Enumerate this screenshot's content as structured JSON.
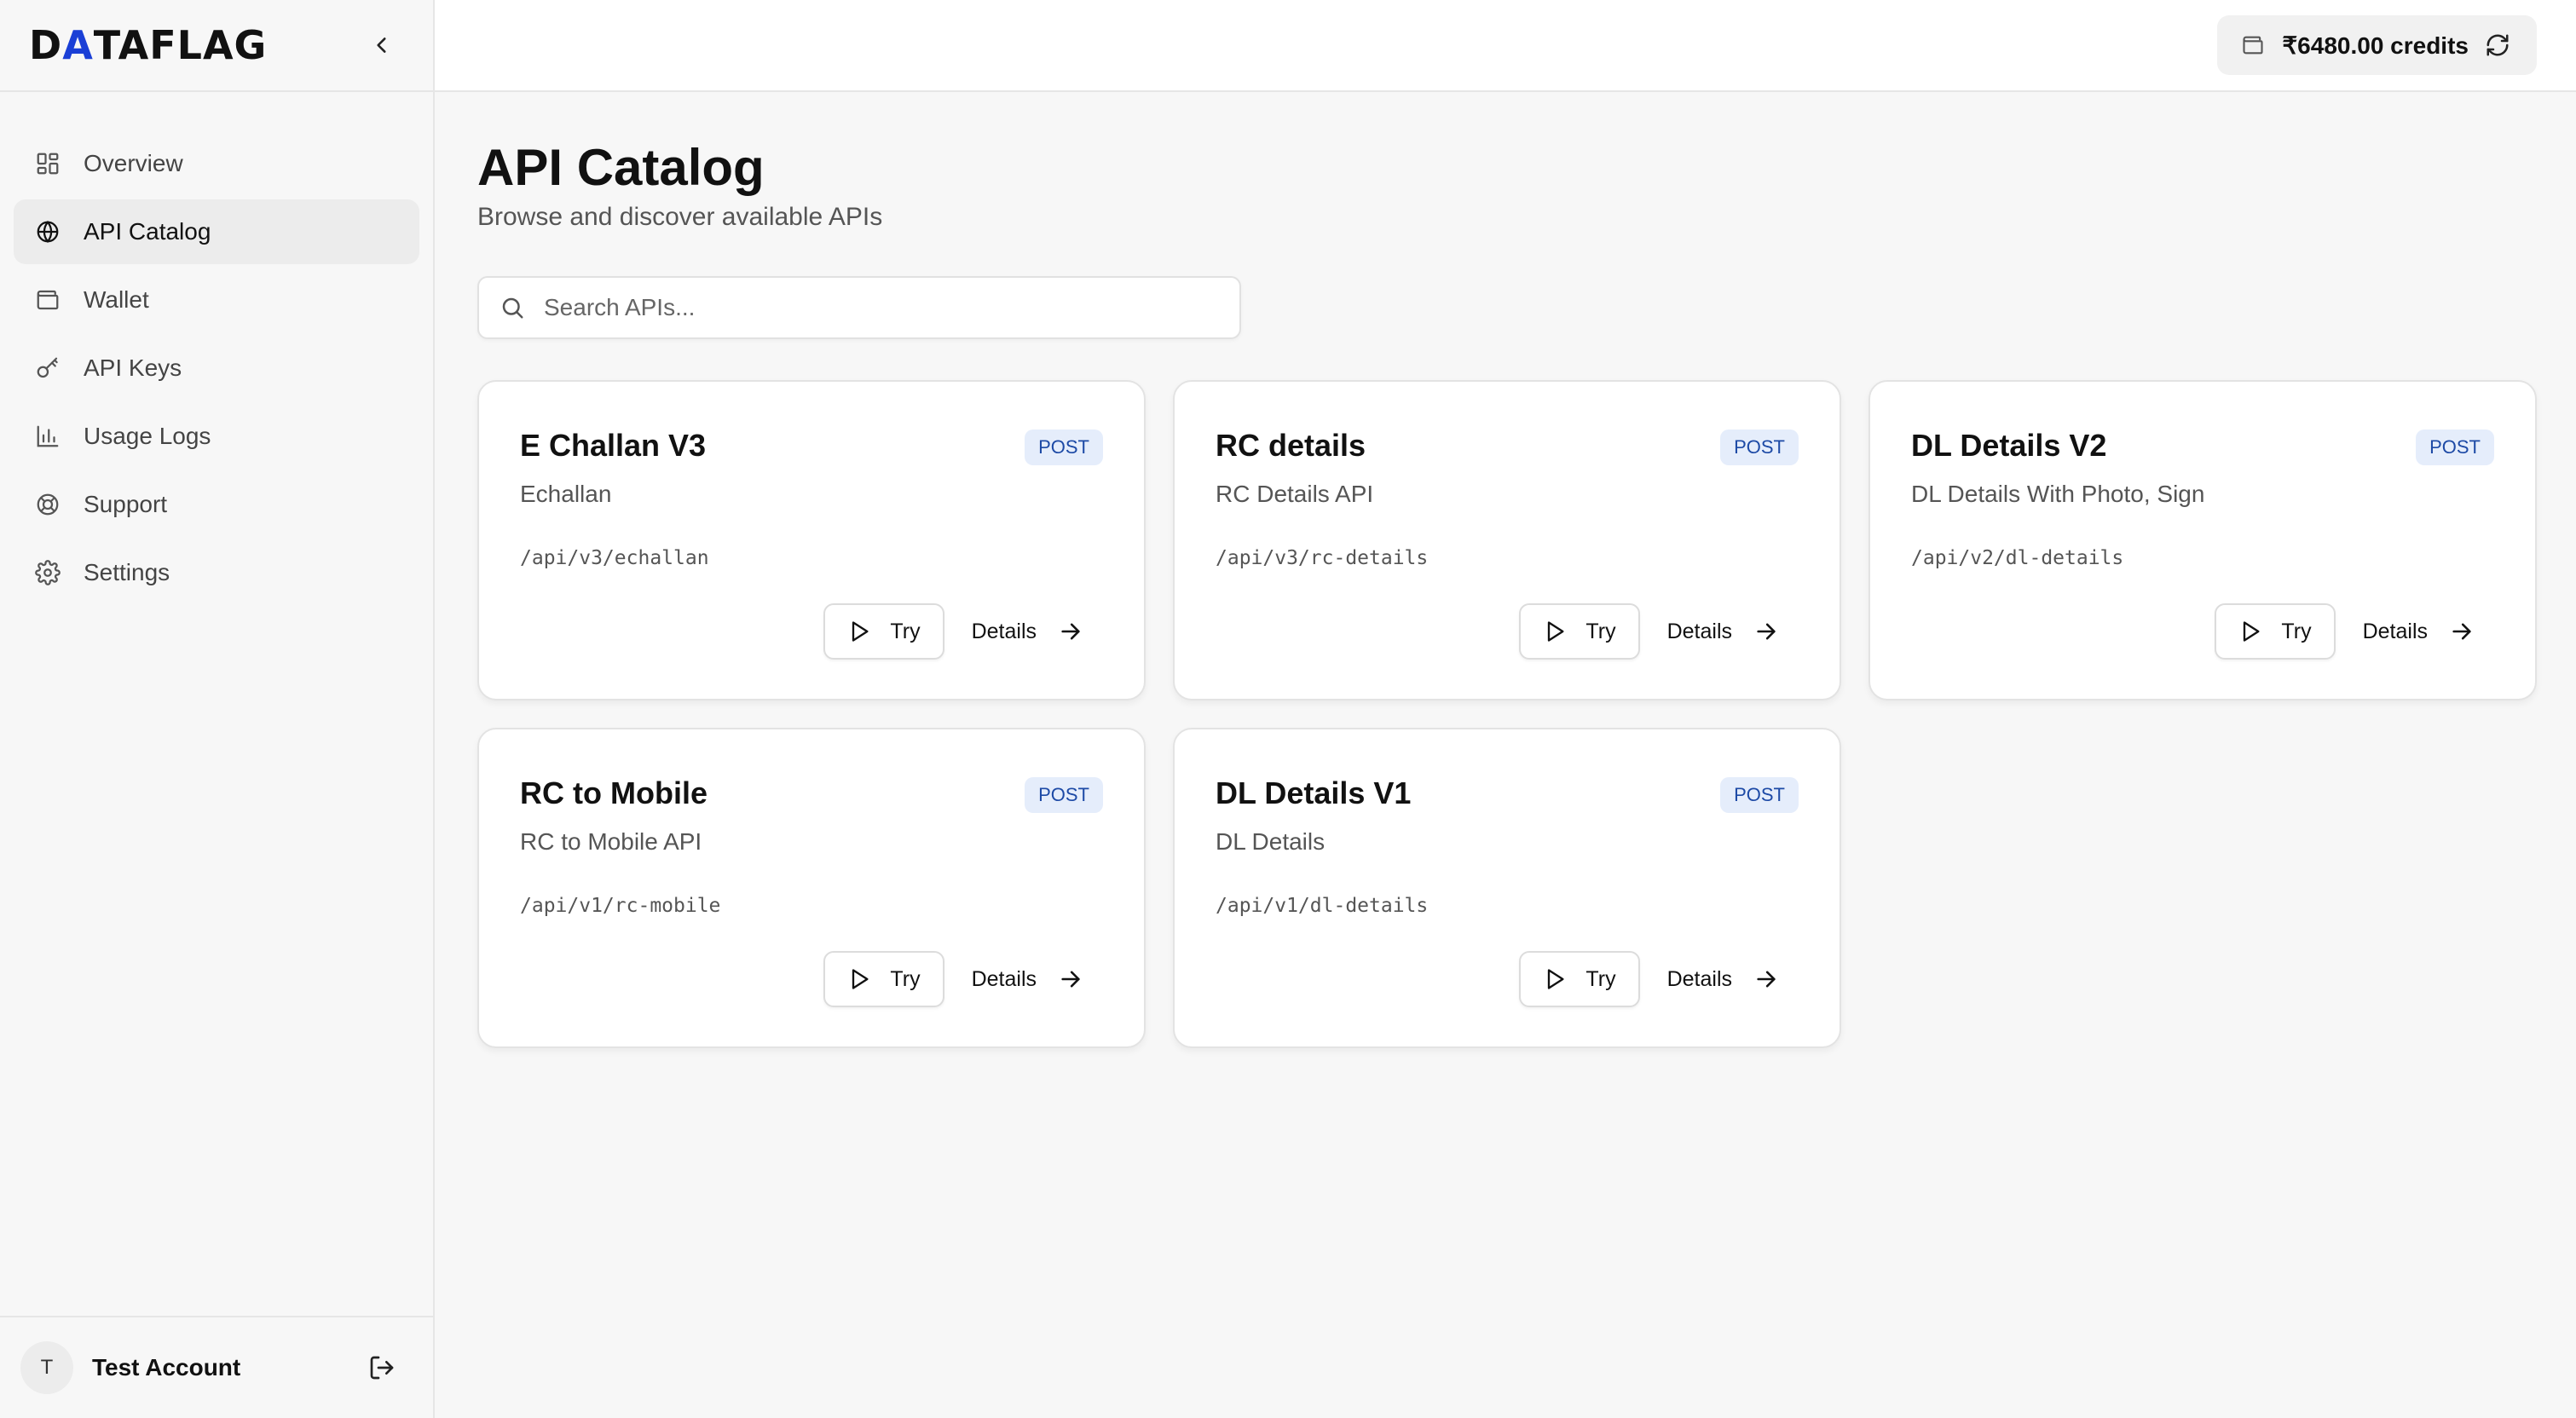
{
  "brand": {
    "logo_pre": "D",
    "logo_mark": "A",
    "logo_post": "TAFLAG"
  },
  "sidebar": {
    "items": [
      {
        "label": "Overview",
        "icon": "grid-icon",
        "active": false
      },
      {
        "label": "API Catalog",
        "icon": "globe-icon",
        "active": true
      },
      {
        "label": "Wallet",
        "icon": "wallet-icon",
        "active": false
      },
      {
        "label": "API Keys",
        "icon": "key-icon",
        "active": false
      },
      {
        "label": "Usage Logs",
        "icon": "bar-chart-icon",
        "active": false
      },
      {
        "label": "Support",
        "icon": "lifebuoy-icon",
        "active": false
      },
      {
        "label": "Settings",
        "icon": "gear-icon",
        "active": false
      }
    ],
    "account": {
      "initial": "T",
      "name": "Test Account"
    }
  },
  "header": {
    "credits": "₹6480.00 credits"
  },
  "main": {
    "title": "API Catalog",
    "subtitle": "Browse and discover available APIs",
    "search_placeholder": "Search APIs..."
  },
  "cards": [
    {
      "title": "E Challan V3",
      "method": "POST",
      "description": "Echallan",
      "path": "/api/v3/echallan",
      "try_label": "Try",
      "details_label": "Details"
    },
    {
      "title": "RC details",
      "method": "POST",
      "description": "RC Details API",
      "path": "/api/v3/rc-details",
      "try_label": "Try",
      "details_label": "Details"
    },
    {
      "title": "DL Details V2",
      "method": "POST",
      "description": "DL Details With Photo, Sign",
      "path": "/api/v2/dl-details",
      "try_label": "Try",
      "details_label": "Details"
    },
    {
      "title": "RC to Mobile",
      "method": "POST",
      "description": "RC to Mobile API",
      "path": "/api/v1/rc-mobile",
      "try_label": "Try",
      "details_label": "Details"
    },
    {
      "title": "DL Details V1",
      "method": "POST",
      "description": "DL Details",
      "path": "/api/v1/dl-details",
      "try_label": "Try",
      "details_label": "Details"
    }
  ],
  "colors": {
    "accent": "#1a3fd6",
    "badge_bg": "#e5edfb",
    "badge_text": "#1d4aa6"
  }
}
